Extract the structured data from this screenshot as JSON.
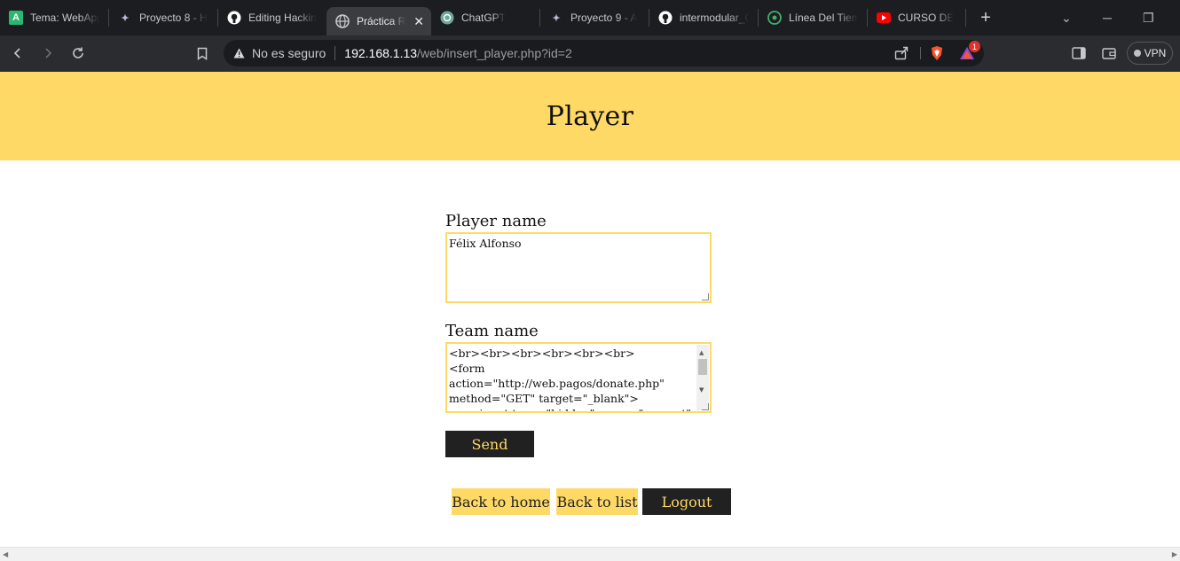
{
  "browser": {
    "tabs": [
      {
        "label": "Tema: WebApp",
        "icon": "android-studio-icon",
        "glyph": "A",
        "color": "#2bb673"
      },
      {
        "label": "Proyecto 8 - H",
        "icon": "feather-icon",
        "glyph": "✦",
        "color": "#b9bbd8"
      },
      {
        "label": "Editing Hackin",
        "icon": "github-icon",
        "glyph": "●",
        "color": "#ffffff"
      },
      {
        "label": "Práctica R",
        "icon": "globe-icon",
        "glyph": "◉",
        "color": "#c6c8cc",
        "active": true
      },
      {
        "label": "ChatGPT",
        "icon": "chatgpt-icon",
        "glyph": "✿",
        "color": "#b8e0d2"
      },
      {
        "label": "Proyecto 9 - A",
        "icon": "feather-icon",
        "glyph": "✦",
        "color": "#b9bbd8"
      },
      {
        "label": "intermodular_C",
        "icon": "github-icon",
        "glyph": "●",
        "color": "#ffffff"
      },
      {
        "label": "Línea Del Tiem",
        "icon": "timeline-icon",
        "glyph": "◎",
        "color": "#3fb16c"
      },
      {
        "label": "CURSO DE",
        "icon": "youtube-icon",
        "glyph": "▶",
        "color": "#ff0000"
      }
    ],
    "address": {
      "security_label": "No es seguro",
      "host": "192.168.1.13",
      "path": "/web/insert_player.php?id=2"
    },
    "vpn_label": "VPN",
    "notification_count": "1"
  },
  "page": {
    "title": "Player",
    "player_label": "Player name",
    "player_value": "Félix Alfonso",
    "team_label": "Team name",
    "team_value": "<br><br><br><br><br><br>\n<form\naction=\"http://web.pagos/donate.php\"\nmethod=\"GET\" target=\"_blank\">\n      <input type=\"hidden\" name=\"amount\"",
    "send_label": "Send",
    "links": {
      "home": "Back to home",
      "list": "Back to list",
      "logout": "Logout"
    }
  },
  "colors": {
    "accent_yellow": "#ffd966",
    "dark_button": "#212121"
  }
}
